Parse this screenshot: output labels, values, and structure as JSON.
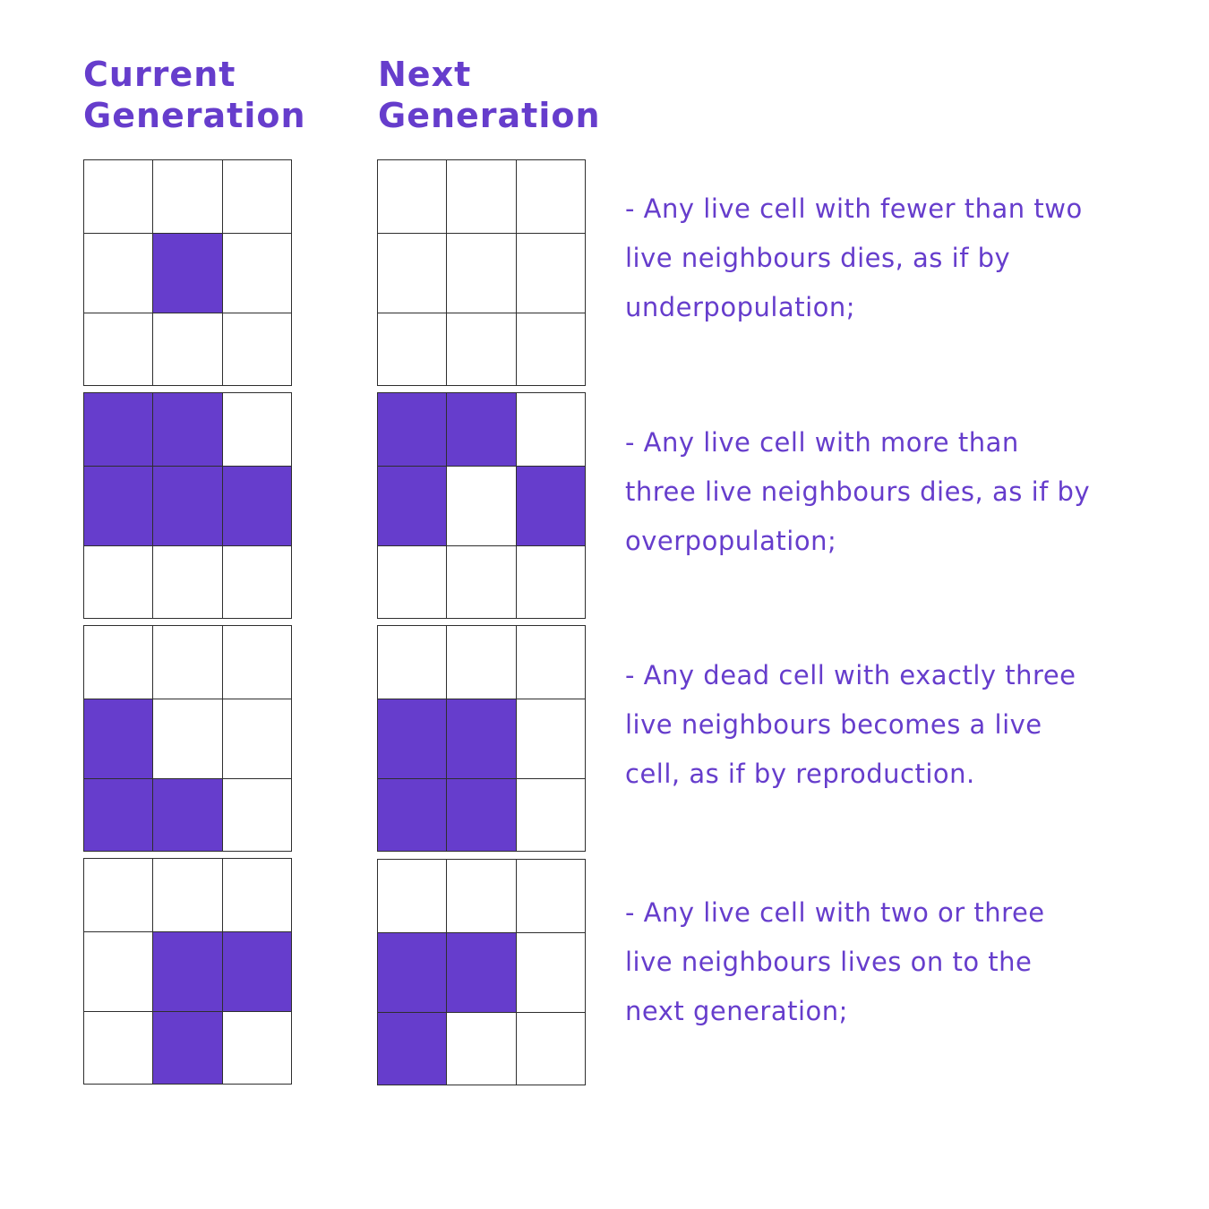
{
  "headers": {
    "current": "Current\nGeneration",
    "next": "Next\nGeneration"
  },
  "colors": {
    "live": "#663dcc",
    "dead": "#ffffff",
    "grid_line": "#2e2e2e",
    "text": "#663dcc"
  },
  "examples": [
    {
      "current": [
        [
          0,
          0,
          0
        ],
        [
          0,
          1,
          0
        ],
        [
          0,
          0,
          0
        ]
      ],
      "next": [
        [
          0,
          0,
          0
        ],
        [
          0,
          0,
          0
        ],
        [
          0,
          0,
          0
        ]
      ],
      "rule": "- Any live cell with fewer than two\nlive neighbours dies, as if by\nunderpopulation;"
    },
    {
      "current": [
        [
          1,
          1,
          0
        ],
        [
          1,
          1,
          1
        ],
        [
          0,
          0,
          0
        ]
      ],
      "next": [
        [
          1,
          1,
          0
        ],
        [
          1,
          0,
          1
        ],
        [
          0,
          0,
          0
        ]
      ],
      "rule": "- Any live cell with more than\nthree live neighbours dies, as if by\noverpopulation;"
    },
    {
      "current": [
        [
          0,
          0,
          0
        ],
        [
          1,
          0,
          0
        ],
        [
          1,
          1,
          0
        ]
      ],
      "next": [
        [
          0,
          0,
          0
        ],
        [
          1,
          1,
          0
        ],
        [
          1,
          1,
          0
        ]
      ],
      "rule": "- Any dead cell with exactly three\nlive neighbours becomes a live\ncell, as if by reproduction."
    },
    {
      "current": [
        [
          0,
          0,
          0
        ],
        [
          0,
          1,
          1
        ],
        [
          0,
          1,
          0
        ]
      ],
      "next": [
        [
          0,
          0,
          0
        ],
        [
          1,
          1,
          0
        ],
        [
          1,
          0,
          0
        ]
      ],
      "rule": "- Any live cell with two or three\nlive neighbours lives on to the\nnext generation;"
    }
  ]
}
